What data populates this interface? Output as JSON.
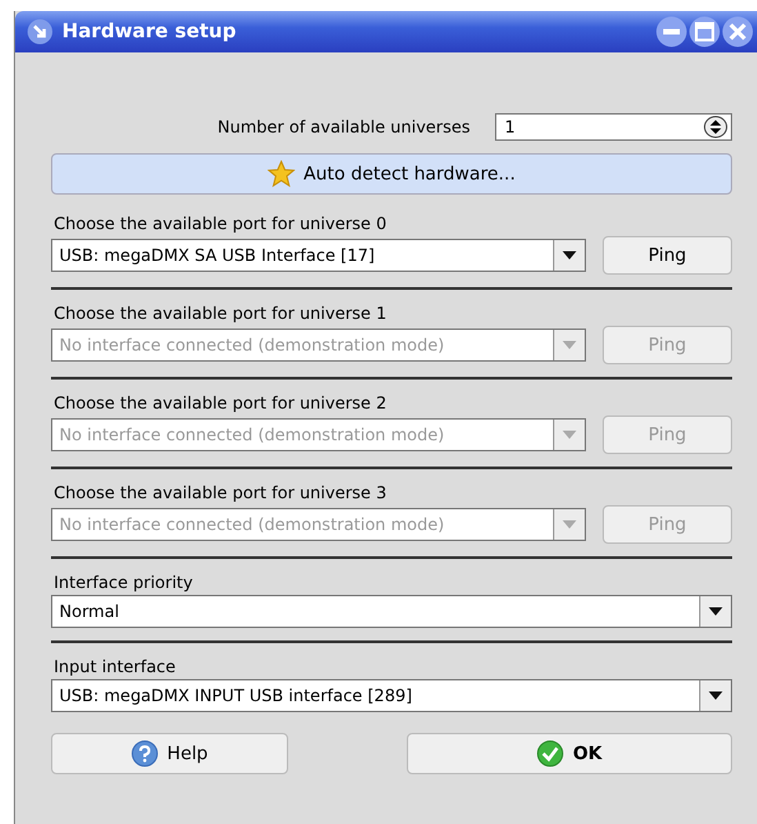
{
  "window": {
    "title": "Hardware setup"
  },
  "universes": {
    "label": "Number of available universes",
    "value": "1"
  },
  "auto_detect": {
    "label": "Auto detect hardware..."
  },
  "ports": [
    {
      "label": "Choose the available port for universe 0",
      "value": "USB: megaDMX SA USB Interface [17]",
      "disabled": false,
      "ping": "Ping"
    },
    {
      "label": "Choose the available port for universe 1",
      "value": "No interface connected (demonstration mode)",
      "disabled": true,
      "ping": "Ping"
    },
    {
      "label": "Choose the available port for universe 2",
      "value": "No interface connected (demonstration mode)",
      "disabled": true,
      "ping": "Ping"
    },
    {
      "label": "Choose the available port for universe 3",
      "value": "No interface connected (demonstration mode)",
      "disabled": true,
      "ping": "Ping"
    }
  ],
  "priority": {
    "label": "Interface priority",
    "value": "Normal"
  },
  "input": {
    "label": "Input interface",
    "value": "USB: megaDMX INPUT USB interface [289]"
  },
  "buttons": [
    {
      "kind": "help",
      "label": "Help"
    },
    {
      "kind": "ok",
      "label": "OK"
    }
  ]
}
